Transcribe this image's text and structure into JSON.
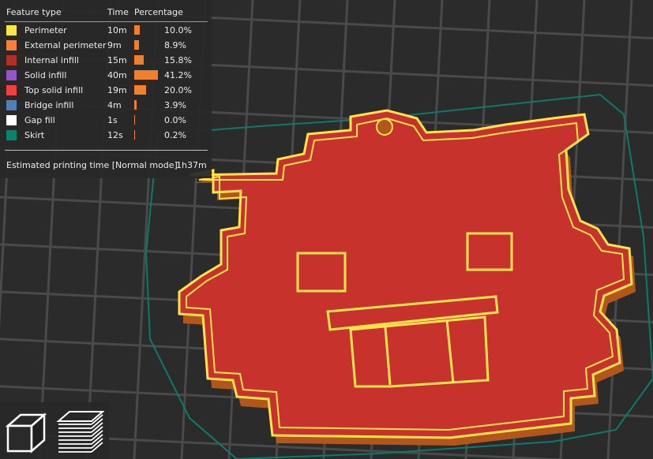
{
  "legend": {
    "headers": {
      "feature": "Feature type",
      "time": "Time",
      "percentage": "Percentage"
    },
    "rows": [
      {
        "name": "Perimeter",
        "time": "10m",
        "pct": "10.0%",
        "value": 10.0,
        "color": "#ffe54d"
      },
      {
        "name": "External perimeter",
        "time": "9m",
        "pct": "8.9%",
        "value": 8.9,
        "color": "#ff7d38"
      },
      {
        "name": "Internal infill",
        "time": "15m",
        "pct": "15.8%",
        "value": 15.8,
        "color": "#b03029"
      },
      {
        "name": "Solid infill",
        "time": "40m",
        "pct": "41.2%",
        "value": 41.2,
        "color": "#9654cc"
      },
      {
        "name": "Top solid infill",
        "time": "19m",
        "pct": "20.0%",
        "value": 20.0,
        "color": "#f04040"
      },
      {
        "name": "Bridge infill",
        "time": "4m",
        "pct": "3.9%",
        "value": 3.9,
        "color": "#4d80ba"
      },
      {
        "name": "Gap fill",
        "time": "1s",
        "pct": "0.0%",
        "value": 0.0,
        "color": "#ffffff"
      },
      {
        "name": "Skirt",
        "time": "12s",
        "pct": "0.2%",
        "value": 0.2,
        "color": "#00876e"
      }
    ],
    "bar_color": "#f47f2b",
    "estimate_label": "Estimated printing time [Normal mode]:",
    "estimate_value": "1h37m"
  },
  "view_buttons": [
    {
      "icon": "iso-view-icon"
    },
    {
      "icon": "layers-view-icon"
    }
  ],
  "colors": {
    "background": "#2b2b2b",
    "grid": "#4a4a4a",
    "top_infill": "#c8322d",
    "perimeter": "#ffe54d",
    "side": "#b3561c",
    "skirt": "#0c7a6a"
  }
}
